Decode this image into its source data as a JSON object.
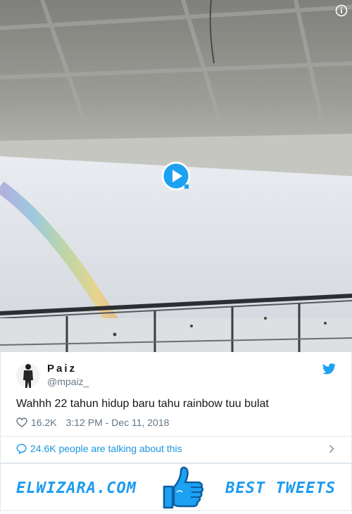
{
  "tweet": {
    "display_name": "Paiz",
    "handle": "@mpaiz_",
    "text": "Wahhh 22 tahun hidup baru tahu rainbow tuu bulat",
    "likes": "16.2K",
    "timestamp": "3:12 PM - Dec 11, 2018",
    "talking": "24.6K people are talking about this"
  },
  "media": {
    "info_icon": "info-icon",
    "play_icon": "play-icon"
  },
  "banner": {
    "left_text": "ELWIZARA.COM",
    "right_text": "BEST TWEETS",
    "icon": "thumbs-up-icon"
  },
  "colors": {
    "accent": "#1da1f2",
    "link": "#1b95e0",
    "muted": "#657786",
    "border": "#e1e8ed"
  }
}
